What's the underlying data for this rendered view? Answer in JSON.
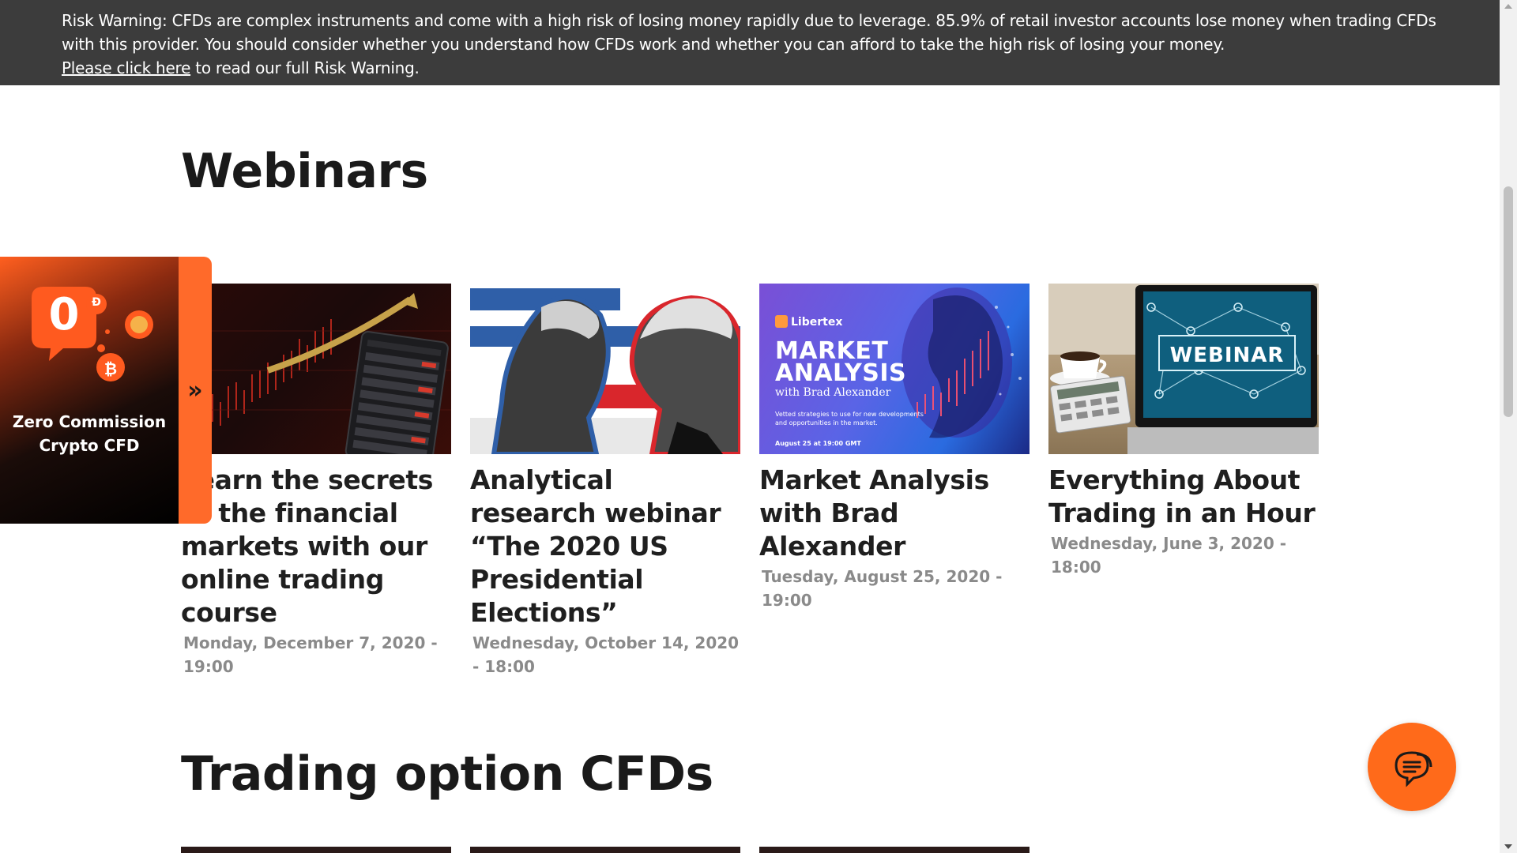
{
  "risk_warning": {
    "text": "Risk Warning: CFDs are complex instruments and come with a high risk of losing money rapidly due to leverage. 85.9% of retail investor accounts lose money when trading CFDs with this provider. You should consider whether you understand how CFDs work and whether you can afford to take the high risk of losing your money.",
    "link_label": "Please click here",
    "link_suffix": " to read our full Risk Warning."
  },
  "sections": {
    "webinars_title": "Webinars",
    "trading_title": "Trading option CFDs"
  },
  "webinars": [
    {
      "title": "Learn the secrets of the financial markets with our online trading course",
      "date": "Monday, December 7, 2020 - 19:00",
      "thumb": "stock-chart-image"
    },
    {
      "title": "Analytical research webinar “The 2020 US Presidential Elections”",
      "date": "Wednesday, October 14, 2020 - 18:00",
      "thumb": "election-image"
    },
    {
      "title": "Market Analysis with Brad Alexander",
      "date": "Tuesday, August 25, 2020 - 19:00",
      "thumb": "market-analysis-image",
      "thumb_text": {
        "brand": "Libertex",
        "headline_1": "MARKET",
        "headline_2": "ANALYSIS",
        "with": "with Brad Alexander",
        "blurb": "Vetted strategies to use for new developments and opportunities in the market.",
        "when": "August 25 at 19:00 GMT"
      }
    },
    {
      "title": "Everything About Trading in an Hour",
      "date": "Wednesday, June 3, 2020 - 18:00",
      "thumb": "webinar-laptop-image",
      "thumb_text": {
        "screen": "WEBINAR"
      }
    }
  ],
  "promo": {
    "badge": "0",
    "text": "Zero Commission Crypto CFD",
    "tab_icon": "double-chevron-right-icon"
  },
  "chat": {
    "icon": "chat-bubble-icon"
  },
  "colors": {
    "accent": "#ff6a1a",
    "banner_bg": "#3c3c3c",
    "date_gray": "#8a8a8a"
  }
}
